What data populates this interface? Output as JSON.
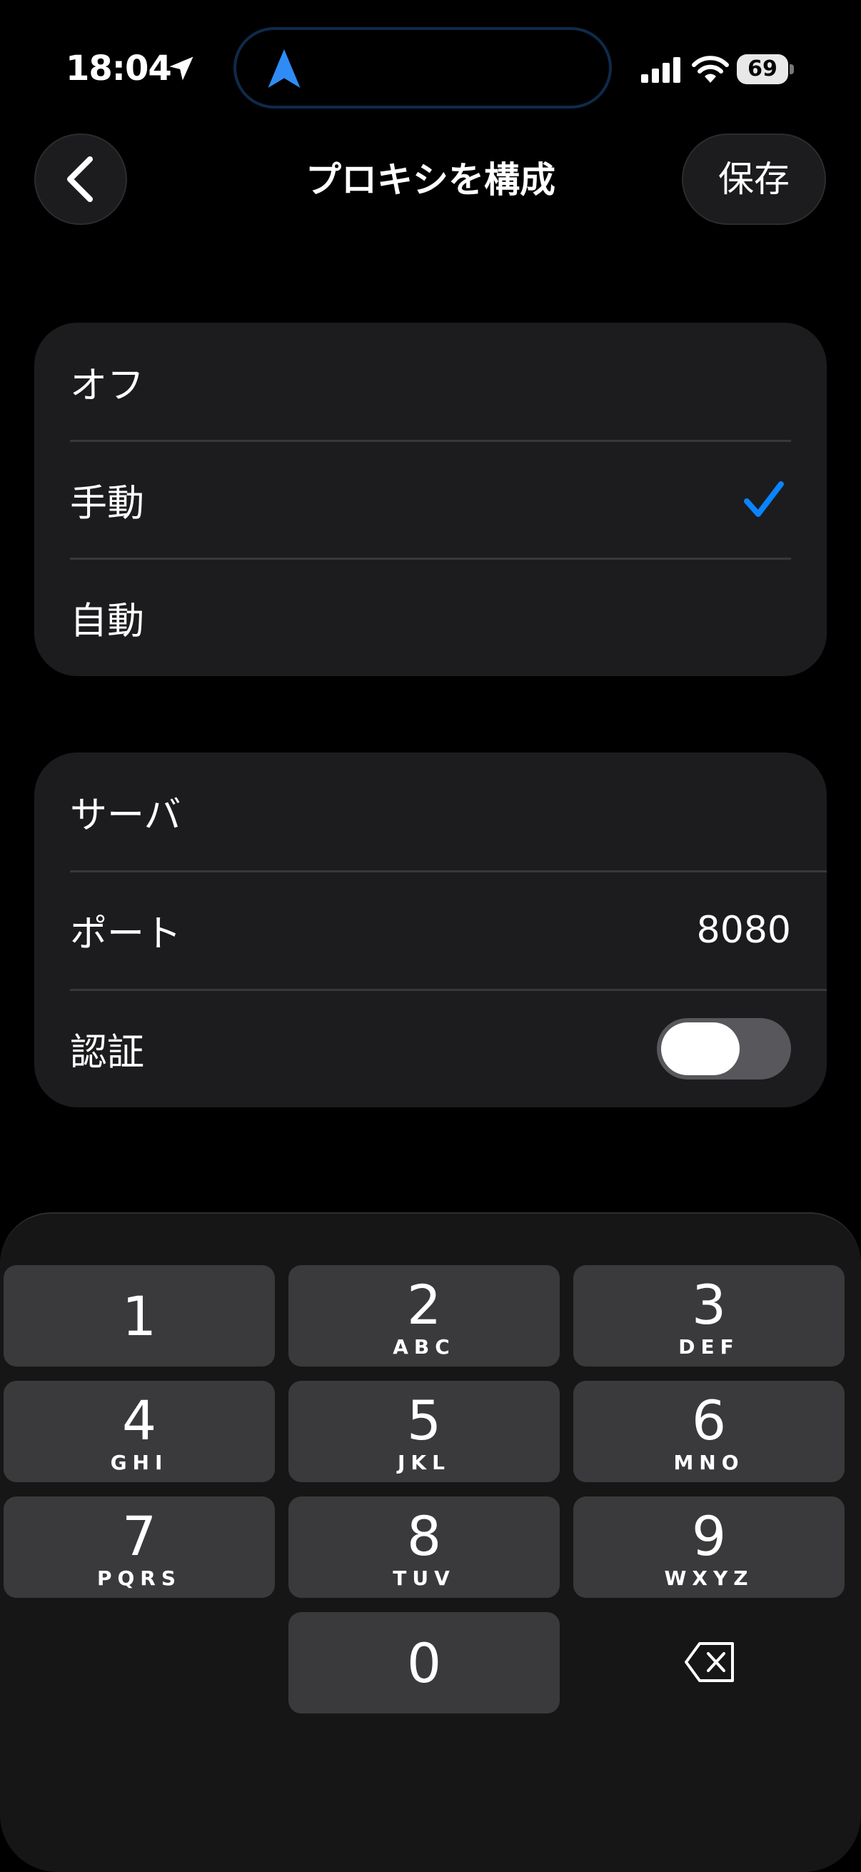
{
  "status_bar": {
    "time": "18:04",
    "battery": "69"
  },
  "nav": {
    "title": "プロキシを構成",
    "save_label": "保存"
  },
  "mode_options": [
    {
      "label": "オフ",
      "selected": false
    },
    {
      "label": "手動",
      "selected": true
    },
    {
      "label": "自動",
      "selected": false
    }
  ],
  "settings": {
    "server_label": "サーバ",
    "port_label": "ポート",
    "port_value": "8080",
    "auth_label": "認証",
    "auth_enabled": false
  },
  "keypad": [
    {
      "digit": "1",
      "letters": ""
    },
    {
      "digit": "2",
      "letters": "ABC"
    },
    {
      "digit": "3",
      "letters": "DEF"
    },
    {
      "digit": "4",
      "letters": "GHI"
    },
    {
      "digit": "5",
      "letters": "JKL"
    },
    {
      "digit": "6",
      "letters": "MNO"
    },
    {
      "digit": "7",
      "letters": "PQRS"
    },
    {
      "digit": "8",
      "letters": "TUV"
    },
    {
      "digit": "9",
      "letters": "WXYZ"
    },
    {
      "digit": "0",
      "letters": ""
    }
  ],
  "colors": {
    "accent": "#0a84ff",
    "group_bg": "#1c1c1e",
    "key_bg": "#3a3a3c"
  }
}
